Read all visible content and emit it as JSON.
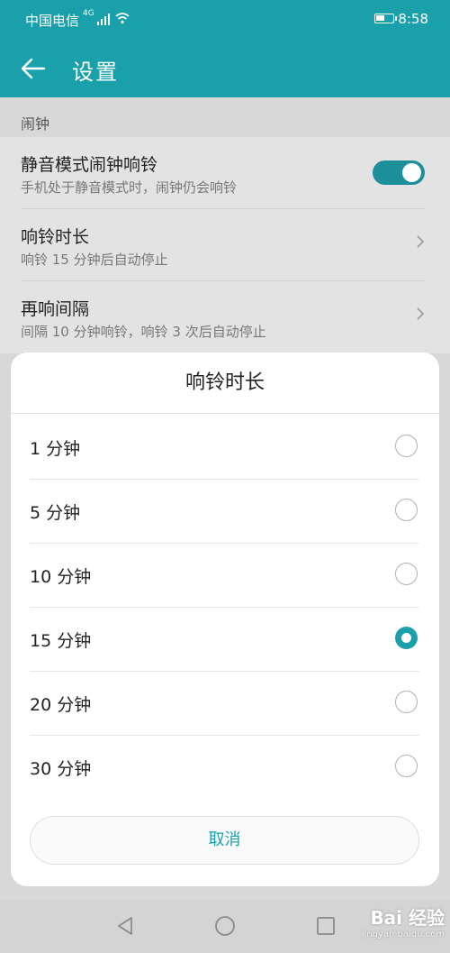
{
  "status_bar": {
    "carrier": "中国电信",
    "network": "4G",
    "time": "8:58"
  },
  "app_bar": {
    "title": "设置",
    "back_icon": "arrow-left-icon"
  },
  "section": {
    "header": "闹钟"
  },
  "settings": {
    "silent_ring": {
      "title": "静音模式闹钟响铃",
      "subtitle": "手机处于静音模式时，闹钟仍会响铃",
      "enabled": true
    },
    "ring_duration": {
      "title": "响铃时长",
      "subtitle": "响铃 15 分钟后自动停止"
    },
    "snooze_interval": {
      "title": "再响间隔",
      "subtitle": "间隔 10 分钟响铃，响铃 3 次后自动停止"
    }
  },
  "dialog": {
    "title": "响铃时长",
    "options": [
      {
        "label": "1 分钟",
        "selected": false
      },
      {
        "label": "5 分钟",
        "selected": false
      },
      {
        "label": "10 分钟",
        "selected": false
      },
      {
        "label": "15 分钟",
        "selected": true
      },
      {
        "label": "20 分钟",
        "selected": false
      },
      {
        "label": "30 分钟",
        "selected": false
      }
    ],
    "cancel_label": "取消"
  },
  "colors": {
    "accent": "#1aa0ab"
  },
  "watermark": {
    "brand": "Bai 经验",
    "url": "jingyan.baidu.com"
  }
}
